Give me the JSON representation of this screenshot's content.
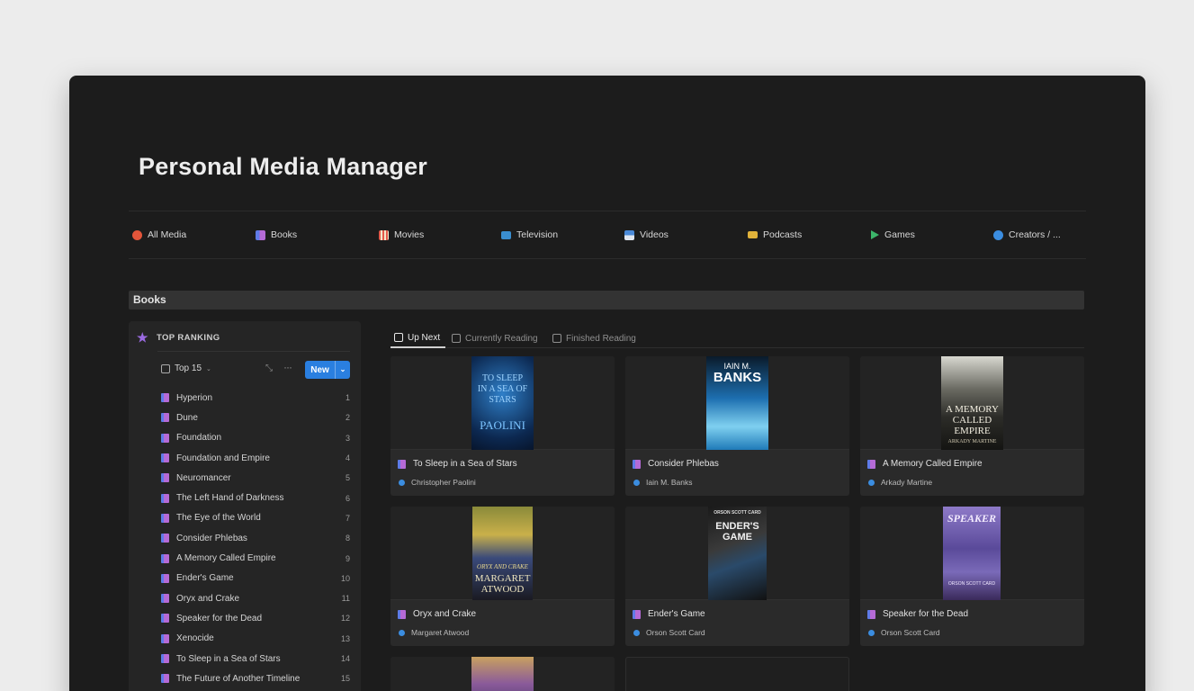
{
  "page": {
    "title": "Personal Media Manager"
  },
  "nav": [
    {
      "label": "All Media",
      "icon": "all-media-icon",
      "color": "#e4553a"
    },
    {
      "label": "Books",
      "icon": "books-icon",
      "color": "#7b6ae0"
    },
    {
      "label": "Movies",
      "icon": "popcorn-icon",
      "color": "#e25a4a"
    },
    {
      "label": "Television",
      "icon": "tv-icon",
      "color": "#3a8ed0"
    },
    {
      "label": "Videos",
      "icon": "film-icon",
      "color": "#4a8ad8"
    },
    {
      "label": "Podcasts",
      "icon": "podcast-icon",
      "color": "#e0b23a"
    },
    {
      "label": "Games",
      "icon": "game-flag-icon",
      "color": "#3cb56a"
    },
    {
      "label": "Creators / ...",
      "icon": "creators-icon",
      "color": "#3b8de0"
    }
  ],
  "section": {
    "title": "Books"
  },
  "sidebar": {
    "heading": "TOP RANKING",
    "view_label": "Top 15",
    "new_label": "New",
    "items": [
      {
        "title": "Hyperion",
        "rank": "1"
      },
      {
        "title": "Dune",
        "rank": "2"
      },
      {
        "title": "Foundation",
        "rank": "3"
      },
      {
        "title": "Foundation and Empire",
        "rank": "4"
      },
      {
        "title": "Neuromancer",
        "rank": "5"
      },
      {
        "title": "The Left Hand of Darkness",
        "rank": "6"
      },
      {
        "title": "The Eye of the World",
        "rank": "7"
      },
      {
        "title": "Consider Phlebas",
        "rank": "8"
      },
      {
        "title": "A Memory Called Empire",
        "rank": "9"
      },
      {
        "title": "Ender's Game",
        "rank": "10"
      },
      {
        "title": "Oryx and Crake",
        "rank": "11"
      },
      {
        "title": "Speaker for the Dead",
        "rank": "12"
      },
      {
        "title": "Xenocide",
        "rank": "13"
      },
      {
        "title": "To Sleep in a Sea of Stars",
        "rank": "14"
      },
      {
        "title": "The Future of Another Timeline",
        "rank": "15"
      }
    ]
  },
  "tabs": [
    {
      "label": "Up Next"
    },
    {
      "label": "Currently Reading"
    },
    {
      "label": "Finished Reading"
    }
  ],
  "cards": [
    {
      "title": "To Sleep in a Sea of Stars",
      "author": "Christopher Paolini",
      "cover_top": "TO SLEEP IN A SEA OF STARS",
      "cover_bottom": "PAOLINI"
    },
    {
      "title": "Consider Phlebas",
      "author": "Iain M. Banks",
      "cover_top": "IAIN M.",
      "cover_bottom": "BANKS"
    },
    {
      "title": "A Memory Called Empire",
      "author": "Arkady Martine",
      "cover_top": "A MEMORY CALLED EMPIRE",
      "cover_bottom": "ARKADY MARTINE"
    },
    {
      "title": "Oryx and Crake",
      "author": "Margaret Atwood",
      "cover_top": "ORYX AND CRAKE",
      "cover_bottom": "MARGARET ATWOOD"
    },
    {
      "title": "Ender's Game",
      "author": "Orson Scott Card",
      "cover_top": "ORSON SCOTT CARD",
      "cover_bottom": "ENDER'S GAME"
    },
    {
      "title": "Speaker for the Dead",
      "author": "Orson Scott Card",
      "cover_top": "SPEAKER",
      "cover_bottom": "ORSON SCOTT CARD"
    }
  ]
}
